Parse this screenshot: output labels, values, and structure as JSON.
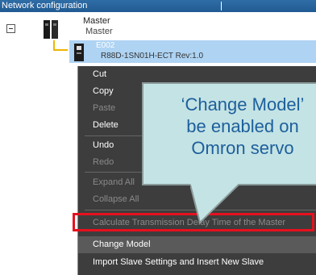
{
  "window": {
    "title": "Network configuration"
  },
  "tree": {
    "master": {
      "name": "Master",
      "type": "Master"
    },
    "slave": {
      "name": "E002",
      "model": "R88D-1SN01H-ECT Rev:1.0"
    }
  },
  "context_menu": {
    "items": [
      {
        "label": "Cut",
        "enabled": true
      },
      {
        "label": "Copy",
        "enabled": true
      },
      {
        "label": "Paste",
        "enabled": false
      },
      {
        "label": "Delete",
        "enabled": true
      },
      {
        "label": "Undo",
        "enabled": true
      },
      {
        "label": "Redo",
        "enabled": false
      },
      {
        "label": "Expand All",
        "enabled": false
      },
      {
        "label": "Collapse All",
        "enabled": false
      },
      {
        "label": "Calculate Transmission Delay Time of the Master",
        "enabled": false
      },
      {
        "label": "Change Model",
        "enabled": true
      },
      {
        "label": "Import Slave Settings and Insert New Slave",
        "enabled": true
      }
    ]
  },
  "callout": {
    "text": "‘Change Model’\nbe enabled on\nOmron servo"
  },
  "colors": {
    "titlebar": "#215a93",
    "menu_bg": "#3d3d3d",
    "selection": "#aed3f3",
    "highlight": "#e8101e",
    "callout_bg": "#c4e3e4",
    "callout_text": "#1d5f9c"
  }
}
